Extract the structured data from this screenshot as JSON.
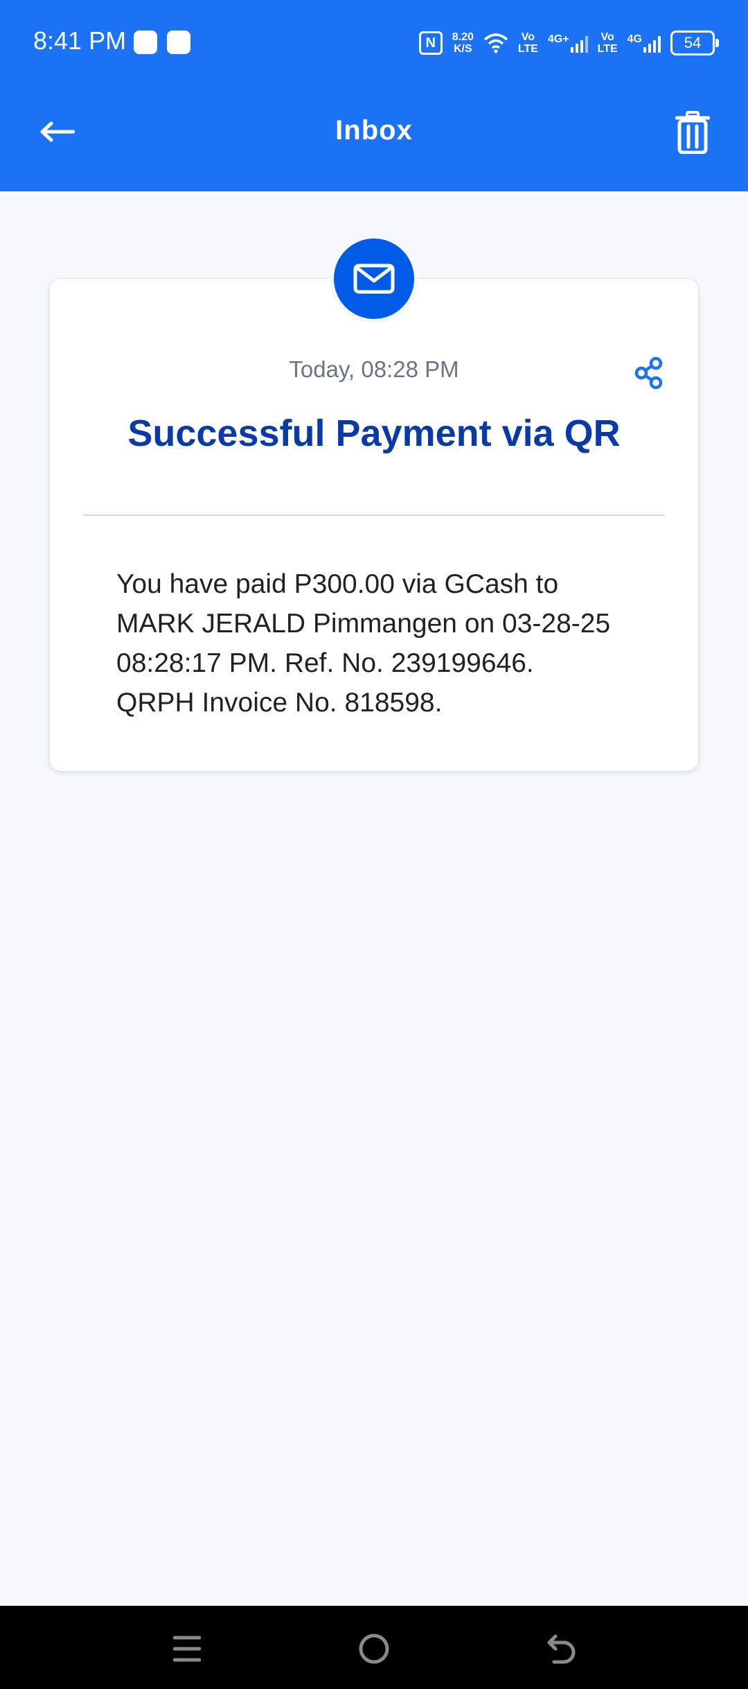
{
  "status_bar": {
    "time": "8:41 PM",
    "net_speed_value": "8.20",
    "net_speed_unit": "K/S",
    "volte1_top": "Vo",
    "volte1_bottom": "LTE",
    "net1": "4G+",
    "volte2_top": "Vo",
    "volte2_bottom": "LTE",
    "net2": "4G",
    "battery": "54",
    "nfc": "N"
  },
  "header": {
    "title": "Inbox",
    "background_color": "#1c72f4"
  },
  "message": {
    "date": "Today, 08:28 PM",
    "title": "Successful Payment via QR",
    "body": "You have paid P300.00 via GCash to MARK JERALD Pimmangen on 03-28-25 08:28:17 PM. Ref. No. 239199646. QRPH Invoice No. 818598.",
    "title_color": "#0a3aa8",
    "icon": "mail-icon",
    "share_icon": "share-icon"
  },
  "icons": {
    "back": "arrow-left-icon",
    "delete": "trash-icon",
    "nav_menu": "menu-icon",
    "nav_home": "home-icon",
    "nav_back": "back-icon"
  }
}
